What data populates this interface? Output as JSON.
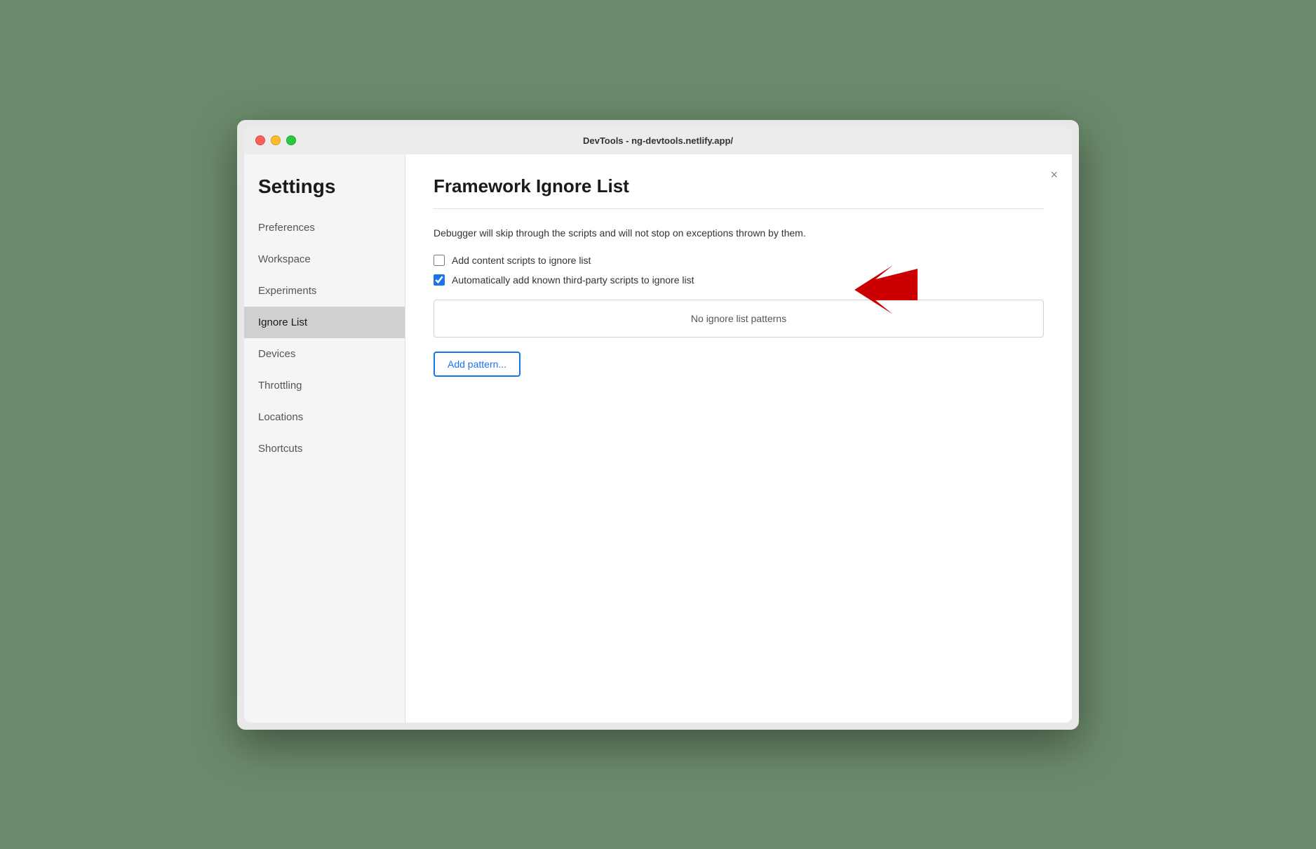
{
  "window": {
    "title": "DevTools - ng-devtools.netlify.app/"
  },
  "sidebar": {
    "heading": "Settings",
    "items": [
      {
        "id": "preferences",
        "label": "Preferences",
        "active": false
      },
      {
        "id": "workspace",
        "label": "Workspace",
        "active": false
      },
      {
        "id": "experiments",
        "label": "Experiments",
        "active": false
      },
      {
        "id": "ignore-list",
        "label": "Ignore List",
        "active": true
      },
      {
        "id": "devices",
        "label": "Devices",
        "active": false
      },
      {
        "id": "throttling",
        "label": "Throttling",
        "active": false
      },
      {
        "id": "locations",
        "label": "Locations",
        "active": false
      },
      {
        "id": "shortcuts",
        "label": "Shortcuts",
        "active": false
      }
    ]
  },
  "main": {
    "title": "Framework Ignore List",
    "description": "Debugger will skip through the scripts and will not stop on exceptions thrown by them.",
    "checkboxes": [
      {
        "id": "add-content-scripts",
        "label": "Add content scripts to ignore list",
        "checked": false
      },
      {
        "id": "auto-add-third-party",
        "label": "Automatically add known third-party scripts to ignore list",
        "checked": true
      }
    ],
    "patterns_placeholder": "No ignore list patterns",
    "add_pattern_label": "Add pattern..."
  },
  "close_button": "×"
}
